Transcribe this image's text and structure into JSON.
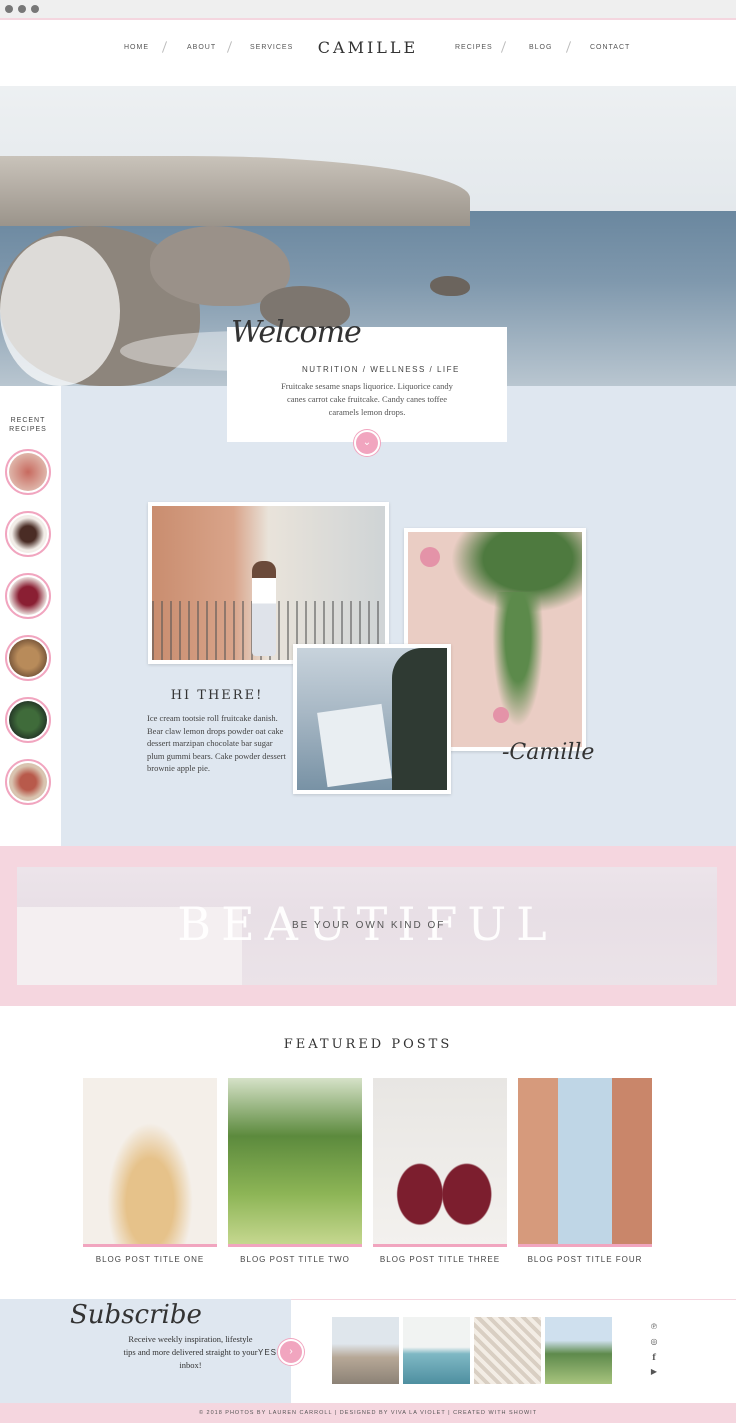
{
  "nav": {
    "brand": "CAMILLE",
    "left_items": [
      "HOME",
      "ABOUT",
      "SERVICES"
    ],
    "right_items": [
      "RECIPES",
      "BLOG",
      "CONTACT"
    ]
  },
  "welcome": {
    "script": "Welcome",
    "tagline": "NUTRITION / WELLNESS / LIFE",
    "body": "Fruitcake sesame snaps liquorice. Liquorice candy canes carrot cake fruitcake. Candy canes toffee caramels lemon drops."
  },
  "recent": {
    "title_line1": "RECENT",
    "title_line2": "RECIPES"
  },
  "about": {
    "title": "HI THERE!",
    "body": "Ice cream tootsie roll fruitcake danish. Bear claw lemon drops powder oat cake dessert marzipan chocolate bar sugar plum gummi bears. Cake powder dessert brownie apple pie.",
    "signature": "-Camille"
  },
  "banner": {
    "big": "BEAUTIFUL",
    "small": "BE YOUR OWN KIND OF"
  },
  "featured": {
    "title": "FEATURED POSTS",
    "posts": [
      {
        "title": "BLOG POST TITLE ONE"
      },
      {
        "title": "BLOG POST TITLE TWO"
      },
      {
        "title": "BLOG POST TITLE THREE"
      },
      {
        "title": "BLOG POST TITLE FOUR"
      }
    ]
  },
  "subscribe": {
    "script": "Subscribe",
    "text": "Receive weekly inspiration, lifestyle tips and more delivered straight to your inbox!",
    "button": "YES!"
  },
  "social_icons": [
    "pinterest-icon",
    "instagram-icon",
    "facebook-icon",
    "youtube-icon"
  ],
  "footer": "© 2018 PHOTOS BY LAUREN CARROLL | DESIGNED BY VIVA LA VIOLET | CREATED WITH SHOWIT",
  "colors": {
    "accent_pink": "#f1a5bf",
    "soft_pink": "#f5d6df",
    "soft_blue": "#dfe7f0"
  }
}
